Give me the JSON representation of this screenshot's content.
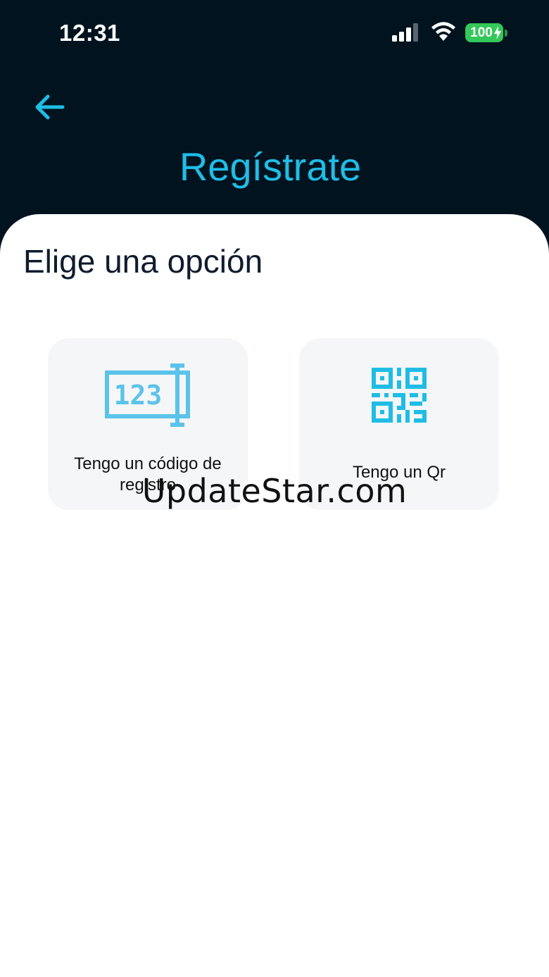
{
  "status_bar": {
    "time": "12:31",
    "battery_level": "100"
  },
  "header": {
    "title": "Regístrate"
  },
  "main": {
    "heading": "Elige una opción",
    "options": [
      {
        "label": "Tengo un código de registro",
        "icon_label": "123",
        "icon": "registration-code-icon"
      },
      {
        "label": "Tengo un Qr",
        "icon": "qr-code-icon"
      }
    ]
  },
  "watermark": "UpdateStar.com",
  "colors": {
    "header_bg": "#00131f",
    "accent": "#1fbde6",
    "code_icon": "#5bc3ea",
    "card_bg": "#f5f6f7",
    "battery": "#34c759"
  }
}
